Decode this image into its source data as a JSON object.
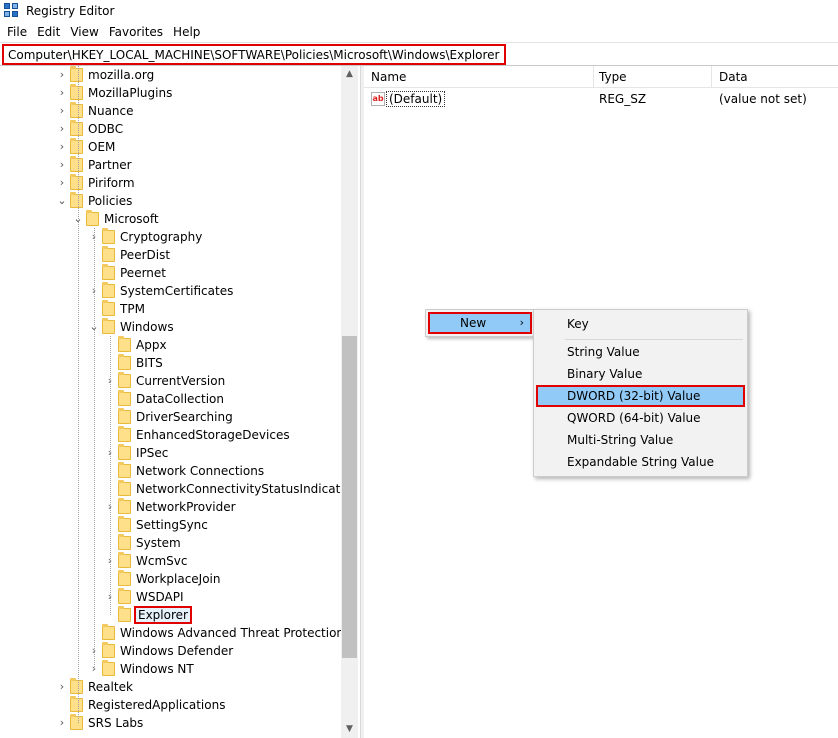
{
  "window": {
    "title": "Registry Editor",
    "icon": "registry-icon"
  },
  "menu": [
    "File",
    "Edit",
    "View",
    "Favorites",
    "Help"
  ],
  "address": "Computer\\HKEY_LOCAL_MACHINE\\SOFTWARE\\Policies\\Microsoft\\Windows\\Explorer",
  "tree": [
    {
      "label": "mozilla.org",
      "depth": 0,
      "expander": "collapsed"
    },
    {
      "label": "MozillaPlugins",
      "depth": 0,
      "expander": "collapsed"
    },
    {
      "label": "Nuance",
      "depth": 0,
      "expander": "collapsed"
    },
    {
      "label": "ODBC",
      "depth": 0,
      "expander": "collapsed"
    },
    {
      "label": "OEM",
      "depth": 0,
      "expander": "collapsed"
    },
    {
      "label": "Partner",
      "depth": 0,
      "expander": "collapsed"
    },
    {
      "label": "Piriform",
      "depth": 0,
      "expander": "collapsed"
    },
    {
      "label": "Policies",
      "depth": 0,
      "expander": "expanded"
    },
    {
      "label": "Microsoft",
      "depth": 1,
      "expander": "expanded"
    },
    {
      "label": "Cryptography",
      "depth": 2,
      "expander": "collapsed"
    },
    {
      "label": "PeerDist",
      "depth": 2,
      "expander": "none"
    },
    {
      "label": "Peernet",
      "depth": 2,
      "expander": "none"
    },
    {
      "label": "SystemCertificates",
      "depth": 2,
      "expander": "collapsed"
    },
    {
      "label": "TPM",
      "depth": 2,
      "expander": "none"
    },
    {
      "label": "Windows",
      "depth": 2,
      "expander": "expanded"
    },
    {
      "label": "Appx",
      "depth": 3,
      "expander": "none"
    },
    {
      "label": "BITS",
      "depth": 3,
      "expander": "none"
    },
    {
      "label": "CurrentVersion",
      "depth": 3,
      "expander": "collapsed"
    },
    {
      "label": "DataCollection",
      "depth": 3,
      "expander": "none"
    },
    {
      "label": "DriverSearching",
      "depth": 3,
      "expander": "none"
    },
    {
      "label": "EnhancedStorageDevices",
      "depth": 3,
      "expander": "none"
    },
    {
      "label": "IPSec",
      "depth": 3,
      "expander": "collapsed"
    },
    {
      "label": "Network Connections",
      "depth": 3,
      "expander": "none"
    },
    {
      "label": "NetworkConnectivityStatusIndicator",
      "depth": 3,
      "expander": "none"
    },
    {
      "label": "NetworkProvider",
      "depth": 3,
      "expander": "collapsed"
    },
    {
      "label": "SettingSync",
      "depth": 3,
      "expander": "none"
    },
    {
      "label": "System",
      "depth": 3,
      "expander": "none"
    },
    {
      "label": "WcmSvc",
      "depth": 3,
      "expander": "collapsed"
    },
    {
      "label": "WorkplaceJoin",
      "depth": 3,
      "expander": "none"
    },
    {
      "label": "WSDAPI",
      "depth": 3,
      "expander": "collapsed"
    },
    {
      "label": "Explorer",
      "depth": 3,
      "expander": "none",
      "selected": true
    },
    {
      "label": "Windows Advanced Threat Protection",
      "depth": 2,
      "expander": "none"
    },
    {
      "label": "Windows Defender",
      "depth": 2,
      "expander": "collapsed"
    },
    {
      "label": "Windows NT",
      "depth": 2,
      "expander": "collapsed"
    },
    {
      "label": "Realtek",
      "depth": 0,
      "expander": "collapsed"
    },
    {
      "label": "RegisteredApplications",
      "depth": 0,
      "expander": "none"
    },
    {
      "label": "SRS Labs",
      "depth": 0,
      "expander": "collapsed"
    }
  ],
  "list": {
    "columns": [
      "Name",
      "Type",
      "Data"
    ],
    "rows": [
      {
        "icon": "ab",
        "name": "(Default)",
        "type": "REG_SZ",
        "data": "(value not set)"
      }
    ]
  },
  "context_menu": {
    "new_label": "New",
    "arrow": "›"
  },
  "submenu": {
    "items": [
      "Key",
      "String Value",
      "Binary Value",
      "DWORD (32-bit) Value",
      "QWORD (64-bit) Value",
      "Multi-String Value",
      "Expandable String Value"
    ],
    "highlighted": "DWORD (32-bit) Value"
  },
  "colors": {
    "highlight_border": "#e00000",
    "menu_hover": "#91c9f7",
    "folder": "#ffe08a"
  }
}
